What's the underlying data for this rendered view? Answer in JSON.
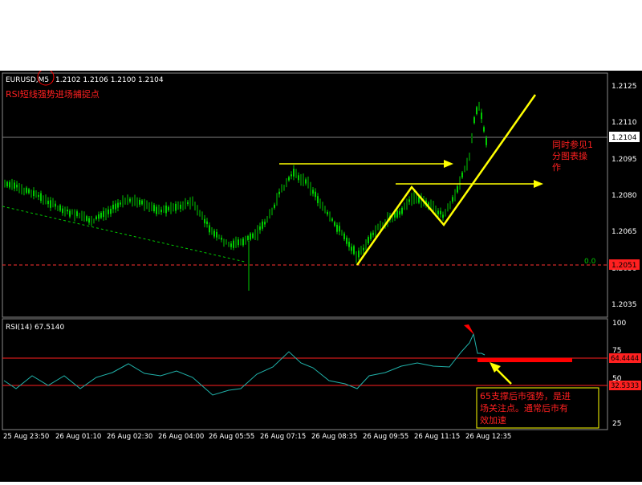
{
  "header": {
    "symbol": "EURUSD,M5",
    "ohlc": "1.2102 1.2106 1.2100 1.2104"
  },
  "annotations": {
    "title_note": "RSI短线强势进场捕捉点",
    "right_note_lines": [
      "同时参见1",
      "分图表操",
      "作"
    ],
    "rsi_note_lines": [
      "65支撑后市强势，是进",
      "场关注点。通常后市有",
      "效加速"
    ],
    "level_zero": "0.0"
  },
  "price_axis": {
    "ticks": [
      "1.2125",
      "1.2110",
      "1.2095",
      "1.2080",
      "1.2065",
      "1.2050",
      "1.2035"
    ],
    "current_price": "1.2104",
    "level_price": "1.2051"
  },
  "rsi": {
    "label": "RSI(14) 67.5140",
    "axis_ticks": [
      "100",
      "75",
      "50",
      "25"
    ],
    "upper_level": "64.4444",
    "lower_level": "32.5333"
  },
  "time_axis": {
    "ticks": [
      "25 Aug 23:50",
      "26 Aug 01:10",
      "26 Aug 02:30",
      "26 Aug 04:00",
      "26 Aug 05:55",
      "26 Aug 07:15",
      "26 Aug 08:35",
      "26 Aug 09:55",
      "26 Aug 11:15",
      "26 Aug 12:35"
    ]
  },
  "colors": {
    "candle": "#00cc00",
    "rsi_line": "#20b2aa",
    "level_line": "#ff2020",
    "annotation_yellow": "#ffff00",
    "annotation_red": "#ff2020"
  }
}
